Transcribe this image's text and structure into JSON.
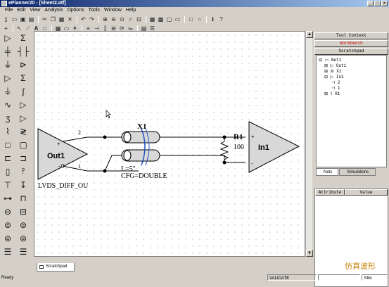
{
  "window": {
    "title": "ePlanner20 - [Sheet2.atf]",
    "controls": [
      "_",
      "□",
      "×"
    ]
  },
  "menu": [
    "File",
    "Edit",
    "View",
    "Analysis",
    "Options",
    "Tools",
    "Window",
    "Help"
  ],
  "toolbar_row1_icons": [
    "new",
    "open",
    "save",
    "print",
    "sep",
    "cut",
    "copy",
    "paste",
    "delete",
    "sep",
    "undo",
    "redo",
    "sep",
    "zoom-in",
    "zoom-out",
    "zoom-fit",
    "zoom-area",
    "zoom-sel",
    "sep",
    "grid",
    "snap",
    "frame",
    "page",
    "sep",
    "rect",
    "ellipse",
    "sep",
    "info",
    "help"
  ],
  "toolbar_row2_icons": [
    "select",
    "sep",
    "pointer",
    "wire",
    "text",
    "sep",
    "grid-toggle",
    "label",
    "sep",
    "probe",
    "stack",
    "port",
    "sep",
    "v",
    "h",
    "rotate",
    "flip",
    "sep",
    "table",
    "list"
  ],
  "schematic": {
    "driver": {
      "name": "Out1",
      "model": "LVDS_DIFF_OU",
      "pin_pos": "2",
      "pin_neg": "1",
      "plus": "+",
      "minus": "-"
    },
    "line": {
      "name": "X1",
      "length": "L=5\"",
      "config": "CFG=DOUBLE"
    },
    "resistor": {
      "name": "R1",
      "value": "100"
    },
    "receiver": {
      "name": "In1",
      "plus": "+",
      "minus": "-"
    }
  },
  "sheet_tab": "Scratchpad",
  "right_panel": {
    "buttons": [
      "Tool Context",
      "Workbench",
      "Scratchpad"
    ],
    "tree": [
      "Net1",
      "Out1",
      "X1",
      "In1",
      "2",
      "1",
      "R1"
    ],
    "tabs": [
      "Nets",
      "Simulations"
    ],
    "attr_headers": [
      "Attribute",
      "Value"
    ]
  },
  "status": {
    "left": "Ready",
    "mode": "VALIDATE",
    "units": "Mils"
  },
  "watermark": "仿真波形",
  "colors": {
    "selected_button_text": "#c00000",
    "component_fill": "#d8d8d8",
    "coax_outline": "#2050c0"
  }
}
